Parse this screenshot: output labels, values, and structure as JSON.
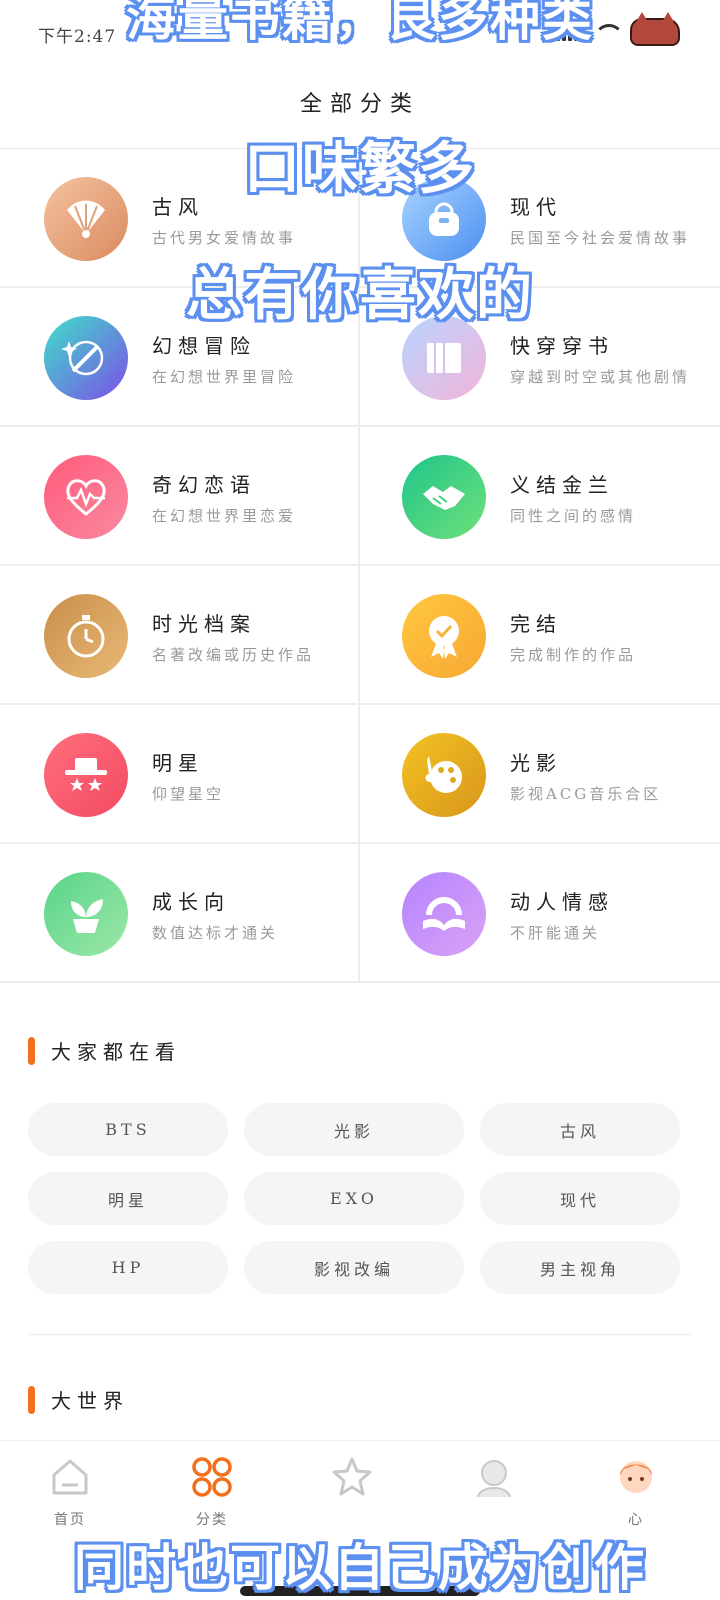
{
  "status_bar": {
    "time": "下午2:47"
  },
  "captions": {
    "top": "海量书籍，良多种类",
    "line1": "口味繁多",
    "line2": "总有你喜欢的",
    "bottom": "同时也可以自己成为创作"
  },
  "page": {
    "title": "全部分类"
  },
  "categories": [
    {
      "name": "古风",
      "desc": "古代男女爱情故事",
      "icon": "fan-icon",
      "color1": "#f5c3a0",
      "color2": "#d98a5f"
    },
    {
      "name": "现代",
      "desc": "民国至今社会爱情故事",
      "icon": "handbag-icon",
      "color1": "#a9d4ff",
      "color2": "#4c8ff0"
    },
    {
      "name": "幻想冒险",
      "desc": "在幻想世界里冒险",
      "icon": "sword-orb-icon",
      "color1": "#3fe0c8",
      "color2": "#7c4ee8"
    },
    {
      "name": "快穿穿书",
      "desc": "穿越到时空或其他剧情",
      "icon": "book-icon",
      "color1": "#b9d4ff",
      "color2": "#f3b4d9"
    },
    {
      "name": "奇幻恋语",
      "desc": "在幻想世界里恋爱",
      "icon": "heartbeat-icon",
      "color1": "#ff5a7a",
      "color2": "#f98aa0"
    },
    {
      "name": "义结金兰",
      "desc": "同性之间的感情",
      "icon": "handshake-icon",
      "color1": "#1fc58a",
      "color2": "#6fe07a"
    },
    {
      "name": "时光档案",
      "desc": "名著改编或历史作品",
      "icon": "stopwatch-icon",
      "color1": "#c98f4a",
      "color2": "#e9b877"
    },
    {
      "name": "完结",
      "desc": "完成制作的作品",
      "icon": "badge-icon",
      "color1": "#ffc83d",
      "color2": "#f8a735"
    },
    {
      "name": "明星",
      "desc": "仰望星空",
      "icon": "star-hat-icon",
      "color1": "#ff6f7d",
      "color2": "#f34a62"
    },
    {
      "name": "光影",
      "desc": "影视ACG音乐合区",
      "icon": "film-reel-icon",
      "color1": "#f3c224",
      "color2": "#d9961b"
    },
    {
      "name": "成长向",
      "desc": "数值达标才通关",
      "icon": "sprout-icon",
      "color1": "#58d48a",
      "color2": "#9de7a8"
    },
    {
      "name": "动人情感",
      "desc": "不肝能通关",
      "icon": "open-book-icon",
      "color1": "#b584ff",
      "color2": "#d9a2f5"
    }
  ],
  "popular": {
    "title": "大家都在看",
    "tags": [
      "BTS",
      "光影",
      "古风",
      "明星",
      "EXO",
      "现代",
      "HP",
      "影视改编",
      "男主视角"
    ]
  },
  "world": {
    "title": "大世界"
  },
  "nav": {
    "home_label": "首页",
    "category_label": "分类",
    "star_label": "",
    "avatar_label": "",
    "profile_label": "心"
  },
  "colors": {
    "accent": "#f2701c",
    "tag_bg": "#f3f5f7",
    "caption_outline": "#5b8ff0"
  }
}
